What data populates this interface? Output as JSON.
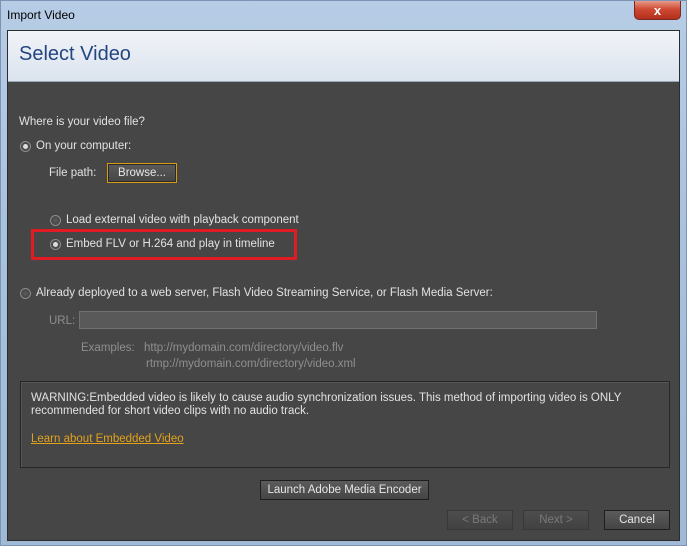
{
  "window": {
    "title": "Import Video",
    "close_glyph": "x"
  },
  "header": {
    "title": "Select Video"
  },
  "question": "Where is your video file?",
  "source": {
    "local_label": "On your computer:",
    "file_path_label": "File path:",
    "browse_label": "Browse...",
    "options": [
      {
        "label": "Load external video with playback component",
        "selected": false
      },
      {
        "label": "Embed FLV or H.264 and play in timeline",
        "selected": true
      }
    ],
    "remote_label": "Already deployed to a web server, Flash Video Streaming Service, or Flash Media Server:",
    "url_label": "URL:",
    "url_value": "",
    "examples_label": "Examples:",
    "example_http": "http://mydomain.com/directory/video.flv",
    "example_rtmp": "rtmp://mydomain.com/directory/video.xml"
  },
  "warning": {
    "text": "WARNING:Embedded video is likely to cause audio synchronization issues. This method of importing video is ONLY recommended for short video clips with no audio track.",
    "link": "Learn about Embedded Video"
  },
  "buttons": {
    "encoder": "Launch Adobe Media Encoder",
    "back": "< Back",
    "next": "Next >",
    "cancel": "Cancel"
  },
  "colors": {
    "highlight": "#e01b24",
    "link": "#e3a21c",
    "header_title": "#23457f"
  }
}
